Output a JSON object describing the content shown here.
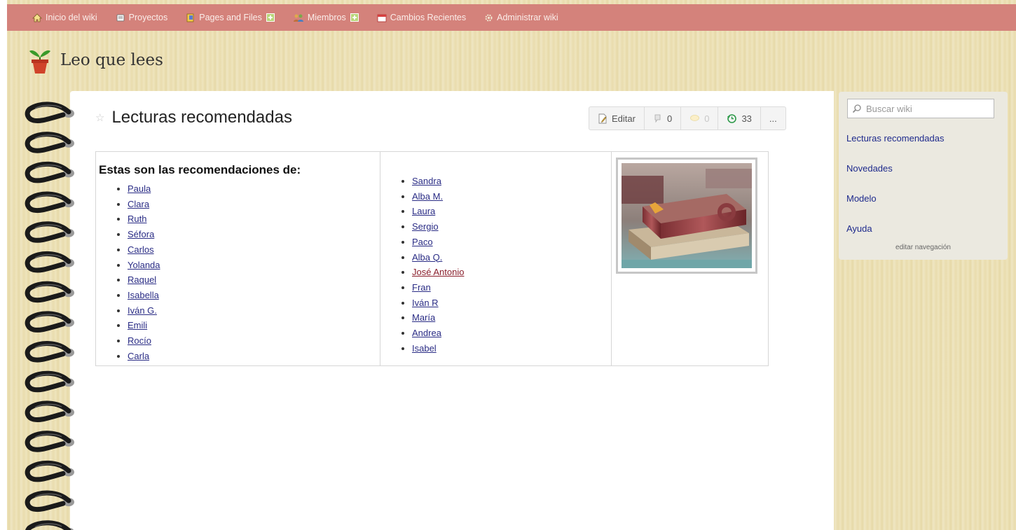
{
  "topnav": {
    "items": [
      {
        "label": "Inicio del wiki",
        "icon": "home-icon",
        "plus": false
      },
      {
        "label": "Proyectos",
        "icon": "projects-icon",
        "plus": false
      },
      {
        "label": "Pages and Files",
        "icon": "pages-icon",
        "plus": true
      },
      {
        "label": "Miembros",
        "icon": "members-icon",
        "plus": true
      },
      {
        "label": "Cambios Recientes",
        "icon": "calendar-icon",
        "plus": false
      },
      {
        "label": "Administrar wiki",
        "icon": "gear-icon",
        "plus": false
      }
    ]
  },
  "site": {
    "name": "Leo que lees",
    "logo_icon": "flower-pot-icon"
  },
  "page": {
    "title": "Lecturas recomendadas",
    "toolbar": {
      "edit_label": "Editar",
      "discussion_count": "0",
      "comments_count": "0",
      "history_count": "33",
      "more_label": "..."
    }
  },
  "table": {
    "heading": "Estas son las recomendaciones de:",
    "col1": [
      "Paula",
      "Clara",
      "Ruth",
      "Séfora",
      "Carlos",
      "Yolanda",
      "Raquel",
      "Isabella",
      "Iván G.",
      "Emili",
      "Rocío",
      "Carla"
    ],
    "col2": [
      "Sandra",
      "Alba M.",
      "Laura",
      "Sergio",
      "Paco",
      "Alba Q.",
      "José Antonio",
      "Fran",
      "Iván R",
      "María",
      "Andrea",
      "Isabel"
    ],
    "col2_visited": "José Antonio",
    "image_icon": "books-photo"
  },
  "sidebar": {
    "search_placeholder": "Buscar wiki",
    "links": [
      "Lecturas recomendadas",
      "Novedades",
      "Modelo",
      "Ayuda"
    ],
    "edit_nav": "editar navegación"
  },
  "colors": {
    "nav_bg": "#d4827b",
    "link": "#2a2c85",
    "visited_link": "#8a1f2c",
    "sidebar_link": "#1e2a8c"
  }
}
